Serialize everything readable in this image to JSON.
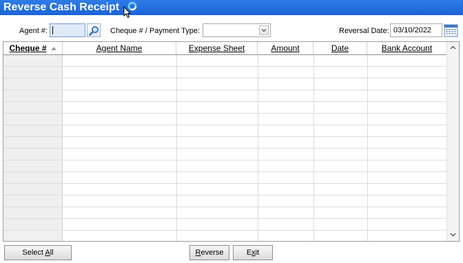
{
  "window": {
    "title": "Reverse Cash Receipt"
  },
  "filters": {
    "agent_label": "Agent #:",
    "agent_value": "",
    "cheque_type_label": "Cheque # / Payment Type:",
    "cheque_type_value": "",
    "reversal_date_label": "Reversal Date:",
    "reversal_date_value": "03/10/2022"
  },
  "table": {
    "columns": [
      "Cheque #",
      "Agent Name",
      "Expense Sheet",
      "Amount",
      "Date",
      "Bank Account"
    ],
    "sorted_column": "Cheque #",
    "sort_direction": "ascending",
    "rows": []
  },
  "buttons": {
    "select_all": {
      "prefix": "Select ",
      "mnemonic": "A",
      "suffix": "ll"
    },
    "reverse": {
      "prefix": "",
      "mnemonic": "R",
      "suffix": "everse"
    },
    "exit": {
      "prefix": "E",
      "mnemonic": "x",
      "suffix": "it"
    }
  },
  "icons": {
    "search": "magnifier-icon",
    "calendar": "calendar-icon",
    "dropdown": "chevron-down-icon",
    "busy": "loading-spinner-icon",
    "cursor": "mouse-pointer-icon"
  },
  "colors": {
    "titlebar": "#1c63d6",
    "grid_border": "#9c9c9c",
    "key_column": "#efefef"
  }
}
